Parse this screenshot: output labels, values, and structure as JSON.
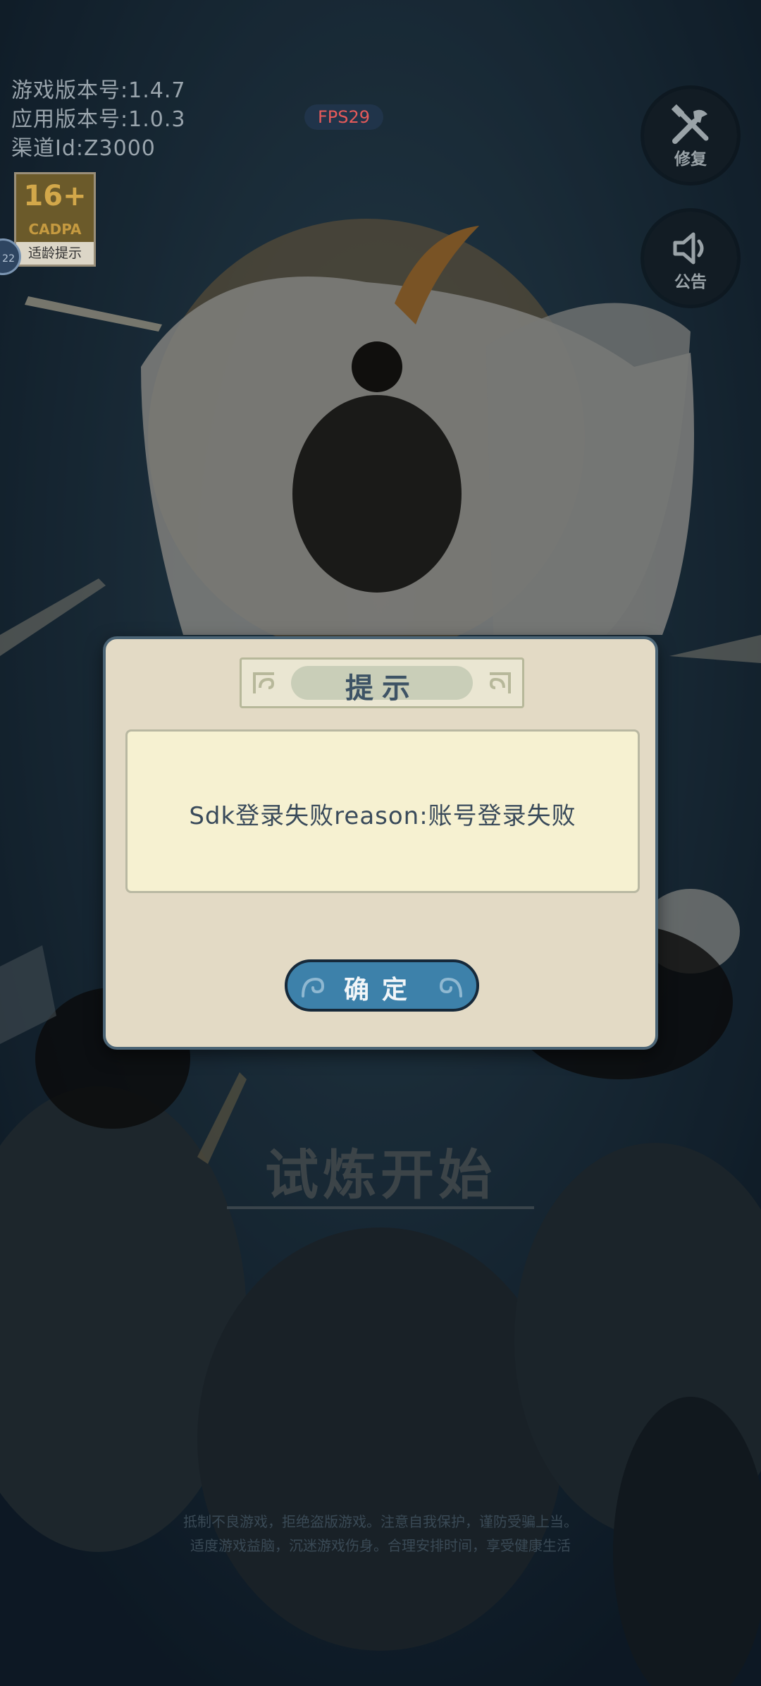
{
  "version_info": {
    "game_version": "游戏版本号:1.4.7",
    "app_version": "应用版本号:1.0.3",
    "channel_id": "渠道Id:Z3000"
  },
  "age_rating": {
    "age": "16+",
    "org": "CADPA",
    "tip": "适龄提示"
  },
  "side_float": {
    "label": "22"
  },
  "fps": "FPS29",
  "buttons": {
    "repair": "修复",
    "notice": "公告"
  },
  "start_text": "试炼开始",
  "health_tip": {
    "line1": "抵制不良游戏，拒绝盗版游戏。注意自我保护，谨防受骗上当。",
    "line2": "适度游戏益脑，沉迷游戏伤身。合理安排时间，享受健康生活"
  },
  "dialog": {
    "title": "提示",
    "message": "Sdk登录失败reason:账号登录失败",
    "confirm": "确定"
  },
  "colors": {
    "dialog_bg": "#e3dac5",
    "message_bg": "#f6f1d1",
    "confirm_button": "#3d81aa",
    "fps_text": "#e55a5a"
  },
  "icons": {
    "repair": "wrench-hammer-icon",
    "notice": "speaker-icon",
    "title_ornament": "cloud-ornament-icon",
    "button_swirl": "swirl-icon"
  }
}
